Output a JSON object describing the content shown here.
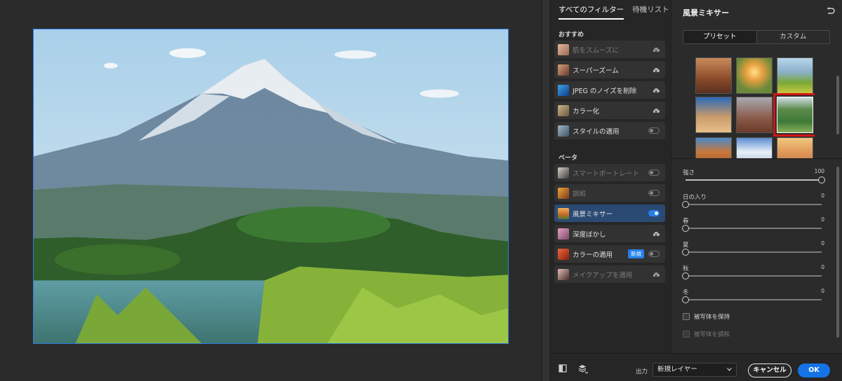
{
  "filter_panel": {
    "tabs": [
      {
        "label": "すべてのフィルター",
        "active": true
      },
      {
        "label": "待機リスト",
        "active": false
      }
    ],
    "featured_title": "おすすめ",
    "featured": [
      {
        "label": "肌をスムーズに",
        "icon": "cloud-download-icon",
        "dim": true
      },
      {
        "label": "スーパーズーム",
        "icon": "cloud-download-icon"
      },
      {
        "label": "JPEG のノイズを削除",
        "icon": "cloud-download-icon"
      },
      {
        "label": "カラー化",
        "icon": "cloud-download-icon"
      },
      {
        "label": "スタイルの適用",
        "toggle": false
      }
    ],
    "beta_title": "ベータ",
    "beta": [
      {
        "label": "スマートポートレート",
        "toggle": false,
        "dim": true
      },
      {
        "label": "調和",
        "toggle": false,
        "dim": true
      },
      {
        "label": "風景ミキサー",
        "toggle": true,
        "selected": true
      },
      {
        "label": "深度ぼかし",
        "icon": "cloud-download-icon"
      },
      {
        "label": "カラーの適用",
        "badge": "新規",
        "toggle": false
      },
      {
        "label": "メイクアップを適用",
        "icon": "cloud-download-icon",
        "dim": true
      }
    ]
  },
  "settings": {
    "title": "風景ミキサー",
    "segments": [
      {
        "label": "プリセット",
        "active": true
      },
      {
        "label": "カスタム",
        "active": false
      }
    ],
    "sliders": [
      {
        "label": "強さ",
        "value": "100",
        "fraction": 1.0
      },
      {
        "label": "日の入り",
        "value": "0",
        "fraction": 0
      },
      {
        "label": "春",
        "value": "0",
        "fraction": 0
      },
      {
        "label": "夏",
        "value": "0",
        "fraction": 0
      },
      {
        "label": "秋",
        "value": "0",
        "fraction": 0
      },
      {
        "label": "冬",
        "value": "0",
        "fraction": 0
      }
    ],
    "checkboxes": [
      {
        "label": "被写体を保持",
        "checked": false,
        "dim": false
      },
      {
        "label": "被写体を調和",
        "checked": false,
        "dim": true
      }
    ]
  },
  "bottom_bar": {
    "output_label": "出力",
    "output_value": "新規レイヤー",
    "cancel_label": "キャンセル",
    "ok_label": "OK"
  },
  "colors": {
    "accent": "#1473e6",
    "selected_row": "#2b4a73",
    "selection_outline": "#d41515"
  }
}
